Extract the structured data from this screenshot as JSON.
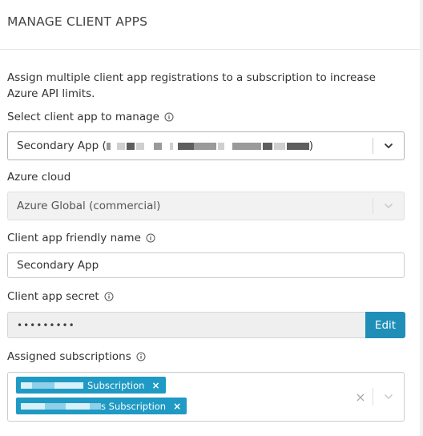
{
  "panel": {
    "title": "MANAGE CLIENT APPS"
  },
  "description": "Assign multiple client app registrations to a subscription to increase Azure API limits.",
  "client_app_select": {
    "label": "Select client app to manage",
    "value_prefix": "Secondary App (",
    "value_suffix": ")"
  },
  "azure_cloud": {
    "label": "Azure cloud",
    "value": "Azure Global (commercial)"
  },
  "friendly_name": {
    "label": "Client app friendly name",
    "value": "Secondary App"
  },
  "client_secret": {
    "label": "Client app secret",
    "masked_value": "•••••••••",
    "edit_label": "Edit"
  },
  "assigned_subscriptions": {
    "label": "Assigned subscriptions",
    "chips": [
      {
        "label": "Subscription",
        "remove": "×"
      },
      {
        "label": "s Subscription",
        "remove": "×"
      }
    ],
    "clear_all": "×"
  },
  "colors": {
    "accent": "#1f8fb8",
    "chip": "#1f9ac4"
  },
  "icons": {
    "info": "info-circle-icon",
    "dropdown": "chevron-down-icon",
    "clear": "close-icon"
  }
}
